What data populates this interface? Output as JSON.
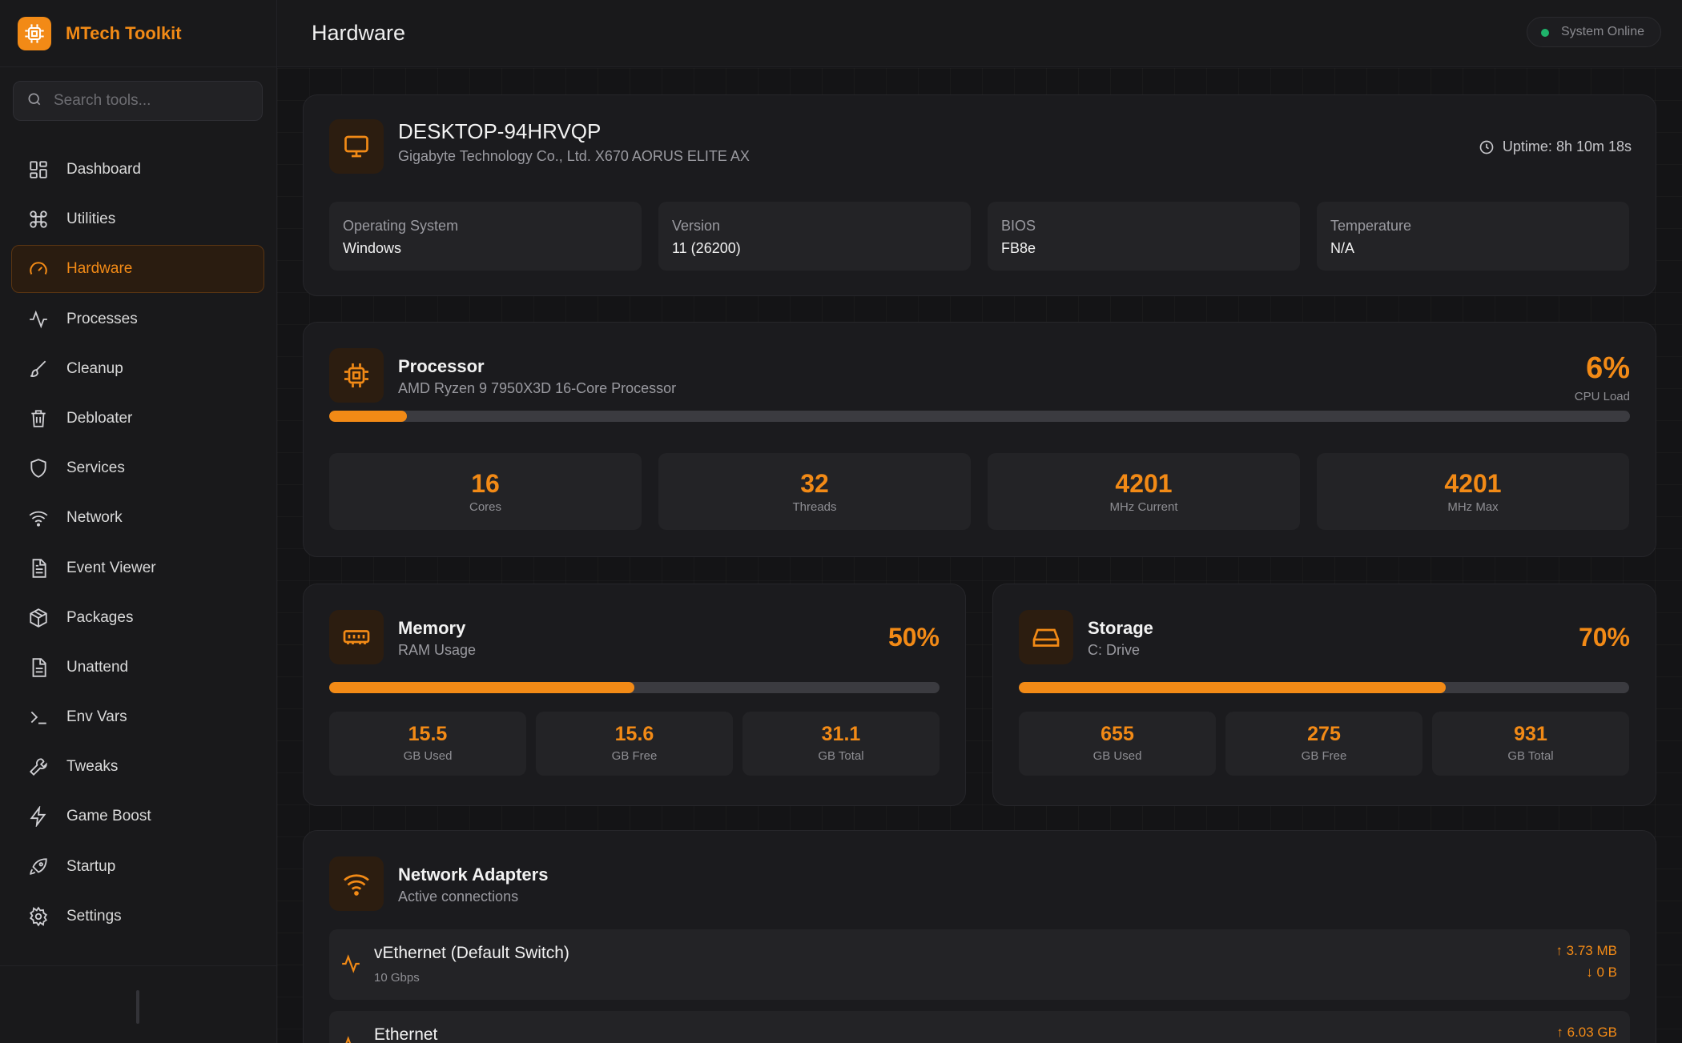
{
  "app": {
    "name": "MTech Toolkit"
  },
  "search": {
    "placeholder": "Search tools..."
  },
  "nav": {
    "items": [
      {
        "label": "Dashboard",
        "icon": "dashboard-grid-icon"
      },
      {
        "label": "Utilities",
        "icon": "command-icon"
      },
      {
        "label": "Hardware",
        "icon": "gauge-icon",
        "active": true
      },
      {
        "label": "Processes",
        "icon": "activity-icon"
      },
      {
        "label": "Cleanup",
        "icon": "brush-icon"
      },
      {
        "label": "Debloater",
        "icon": "trash-icon"
      },
      {
        "label": "Services",
        "icon": "shield-icon"
      },
      {
        "label": "Network",
        "icon": "wifi-icon"
      },
      {
        "label": "Event Viewer",
        "icon": "document-icon"
      },
      {
        "label": "Packages",
        "icon": "package-icon"
      },
      {
        "label": "Unattend",
        "icon": "file-text-icon"
      },
      {
        "label": "Env Vars",
        "icon": "terminal-icon"
      },
      {
        "label": "Tweaks",
        "icon": "wrench-icon"
      },
      {
        "label": "Game Boost",
        "icon": "lightning-icon"
      },
      {
        "label": "Startup",
        "icon": "rocket-icon"
      },
      {
        "label": "Settings",
        "icon": "gear-icon"
      }
    ]
  },
  "header": {
    "title": "Hardware",
    "status": "System Online"
  },
  "system": {
    "hostname": "DESKTOP-94HRVQP",
    "board": "Gigabyte Technology Co., Ltd. X670 AORUS ELITE AX",
    "uptime": "Uptime: 8h 10m 18s",
    "tiles": [
      {
        "label": "Operating System",
        "value": "Windows"
      },
      {
        "label": "Version",
        "value": "11 (26200)"
      },
      {
        "label": "BIOS",
        "value": "FB8e"
      },
      {
        "label": "Temperature",
        "value": "N/A"
      }
    ]
  },
  "processor": {
    "title": "Processor",
    "model": "AMD Ryzen 9 7950X3D 16-Core Processor",
    "load": "6%",
    "load_label": "CPU Load",
    "load_fraction": 0.06,
    "stats": [
      {
        "value": "16",
        "label": "Cores"
      },
      {
        "value": "32",
        "label": "Threads"
      },
      {
        "value": "4201",
        "label": "MHz Current"
      },
      {
        "value": "4201",
        "label": "MHz Max"
      }
    ]
  },
  "memory": {
    "title": "Memory",
    "subtitle": "RAM Usage",
    "percent": "50%",
    "fraction": 0.5,
    "stats": [
      {
        "value": "15.5",
        "label": "GB Used"
      },
      {
        "value": "15.6",
        "label": "GB Free"
      },
      {
        "value": "31.1",
        "label": "GB Total"
      }
    ]
  },
  "storage": {
    "title": "Storage",
    "subtitle": "C: Drive",
    "percent": "70%",
    "fraction": 0.7,
    "stats": [
      {
        "value": "655",
        "label": "GB Used"
      },
      {
        "value": "275",
        "label": "GB Free"
      },
      {
        "value": "931",
        "label": "GB Total"
      }
    ]
  },
  "network": {
    "title": "Network Adapters",
    "subtitle": "Active connections",
    "adapters": [
      {
        "name": "vEthernet (Default Switch)",
        "speed": "10 Gbps",
        "up": "↑ 3.73 MB",
        "down": "↓ 0 B"
      },
      {
        "name": "Ethernet",
        "speed": "",
        "up": "↑ 6.03 GB",
        "down": ""
      }
    ]
  },
  "colors": {
    "accent": "#f28a16",
    "background": "#141416",
    "card": "#1b1b1e",
    "online": "#1fb36b"
  }
}
